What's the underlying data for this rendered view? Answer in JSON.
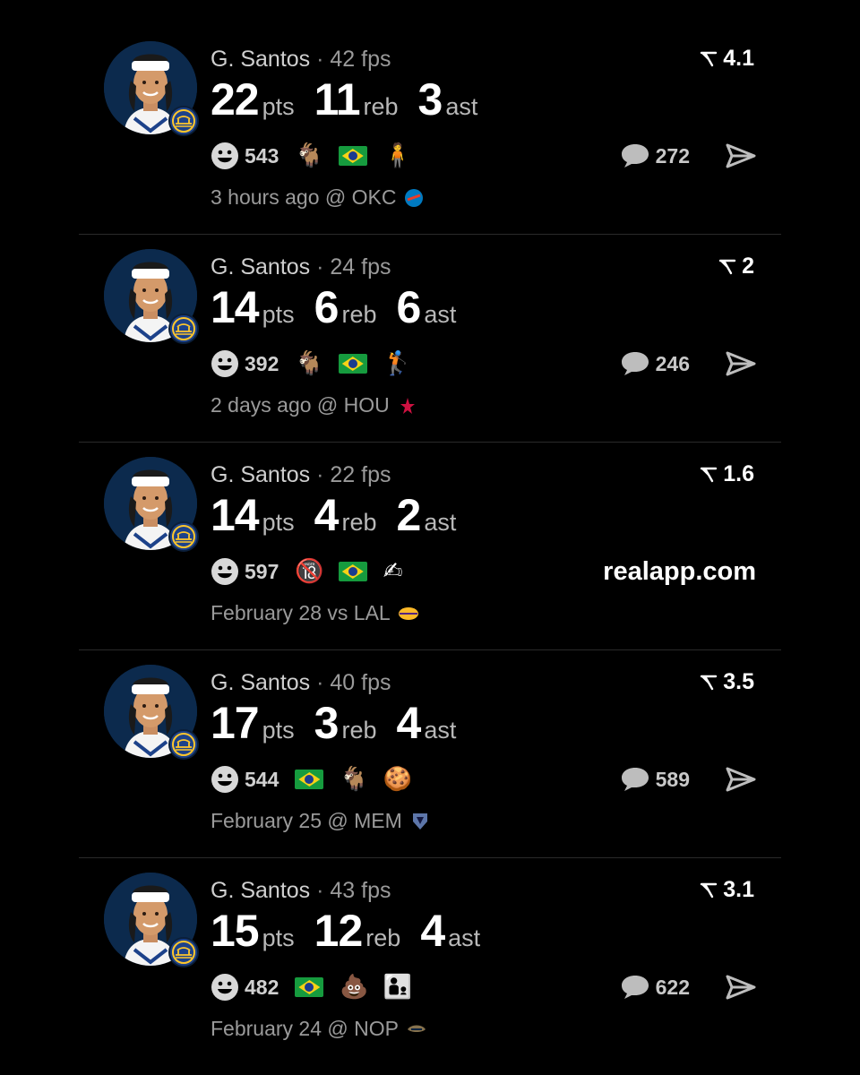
{
  "colors": {
    "background": "#000000",
    "divider": "#2a2a2a",
    "team_blue": "#1d428a",
    "team_gold": "#ffc72c"
  },
  "posts": [
    {
      "player": "G. Santos",
      "sep": "·",
      "fps": "42 fps",
      "rank": "4.1",
      "pts": "22",
      "pts_label": "pts",
      "reb": "11",
      "reb_label": "reb",
      "ast": "3",
      "ast_label": "ast",
      "reactions": "543",
      "reaction_emojis": [
        "goat",
        "brazil-flag",
        "person"
      ],
      "comments": "272",
      "site": "",
      "when": "3 hours ago @ OKC",
      "opponent_logo": "okc-logo"
    },
    {
      "player": "G. Santos",
      "sep": "·",
      "fps": "24 fps",
      "rank": "2",
      "pts": "14",
      "pts_label": "pts",
      "reb": "6",
      "reb_label": "reb",
      "ast": "6",
      "ast_label": "ast",
      "reactions": "392",
      "reaction_emojis": [
        "goat",
        "brazil-flag",
        "golfer"
      ],
      "comments": "246",
      "site": "",
      "when": "2 days ago @ HOU",
      "opponent_logo": "hou-logo"
    },
    {
      "player": "G. Santos",
      "sep": "·",
      "fps": "22 fps",
      "rank": "1.6",
      "pts": "14",
      "pts_label": "pts",
      "reb": "4",
      "reb_label": "reb",
      "ast": "2",
      "ast_label": "ast",
      "reactions": "597",
      "reaction_emojis": [
        "no-under-18",
        "brazil-flag",
        "writing-hand"
      ],
      "comments": "",
      "site": "realapp.com",
      "when": "February 28 vs LAL",
      "opponent_logo": "lal-logo"
    },
    {
      "player": "G. Santos",
      "sep": "·",
      "fps": "40 fps",
      "rank": "3.5",
      "pts": "17",
      "pts_label": "pts",
      "reb": "3",
      "reb_label": "reb",
      "ast": "4",
      "ast_label": "ast",
      "reactions": "544",
      "reaction_emojis": [
        "brazil-flag",
        "goat",
        "cookie"
      ],
      "comments": "589",
      "site": "",
      "when": "February 25 @ MEM",
      "opponent_logo": "mem-logo"
    },
    {
      "player": "G. Santos",
      "sep": "·",
      "fps": "43 fps",
      "rank": "3.1",
      "pts": "15",
      "pts_label": "pts",
      "reb": "12",
      "reb_label": "reb",
      "ast": "4",
      "ast_label": "ast",
      "reactions": "482",
      "reaction_emojis": [
        "brazil-flag",
        "poop",
        "family"
      ],
      "comments": "622",
      "site": "",
      "when": "February 24 @ NOP",
      "opponent_logo": "nop-logo"
    }
  ]
}
